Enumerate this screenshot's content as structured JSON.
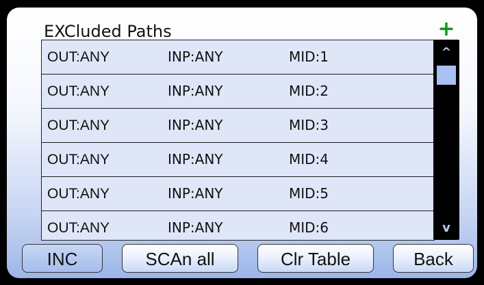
{
  "screen": {
    "title": "EXCluded Paths",
    "add_label": "+",
    "accent_color": "#109a10"
  },
  "table": {
    "rows": [
      {
        "out": "OUT:ANY",
        "inp": "INP:ANY",
        "mid": "MID:1"
      },
      {
        "out": "OUT:ANY",
        "inp": "INP:ANY",
        "mid": "MID:2"
      },
      {
        "out": "OUT:ANY",
        "inp": "INP:ANY",
        "mid": "MID:3"
      },
      {
        "out": "OUT:ANY",
        "inp": "INP:ANY",
        "mid": "MID:4"
      },
      {
        "out": "OUT:ANY",
        "inp": "INP:ANY",
        "mid": "MID:5"
      },
      {
        "out": "OUT:ANY",
        "inp": "INP:ANY",
        "mid": "MID:6"
      }
    ]
  },
  "scrollbar": {
    "up_label": "^",
    "down_label": "v"
  },
  "buttons": {
    "inc": "INC",
    "scan_all": "SCAn all",
    "clr_table": "Clr Table",
    "back": "Back"
  }
}
